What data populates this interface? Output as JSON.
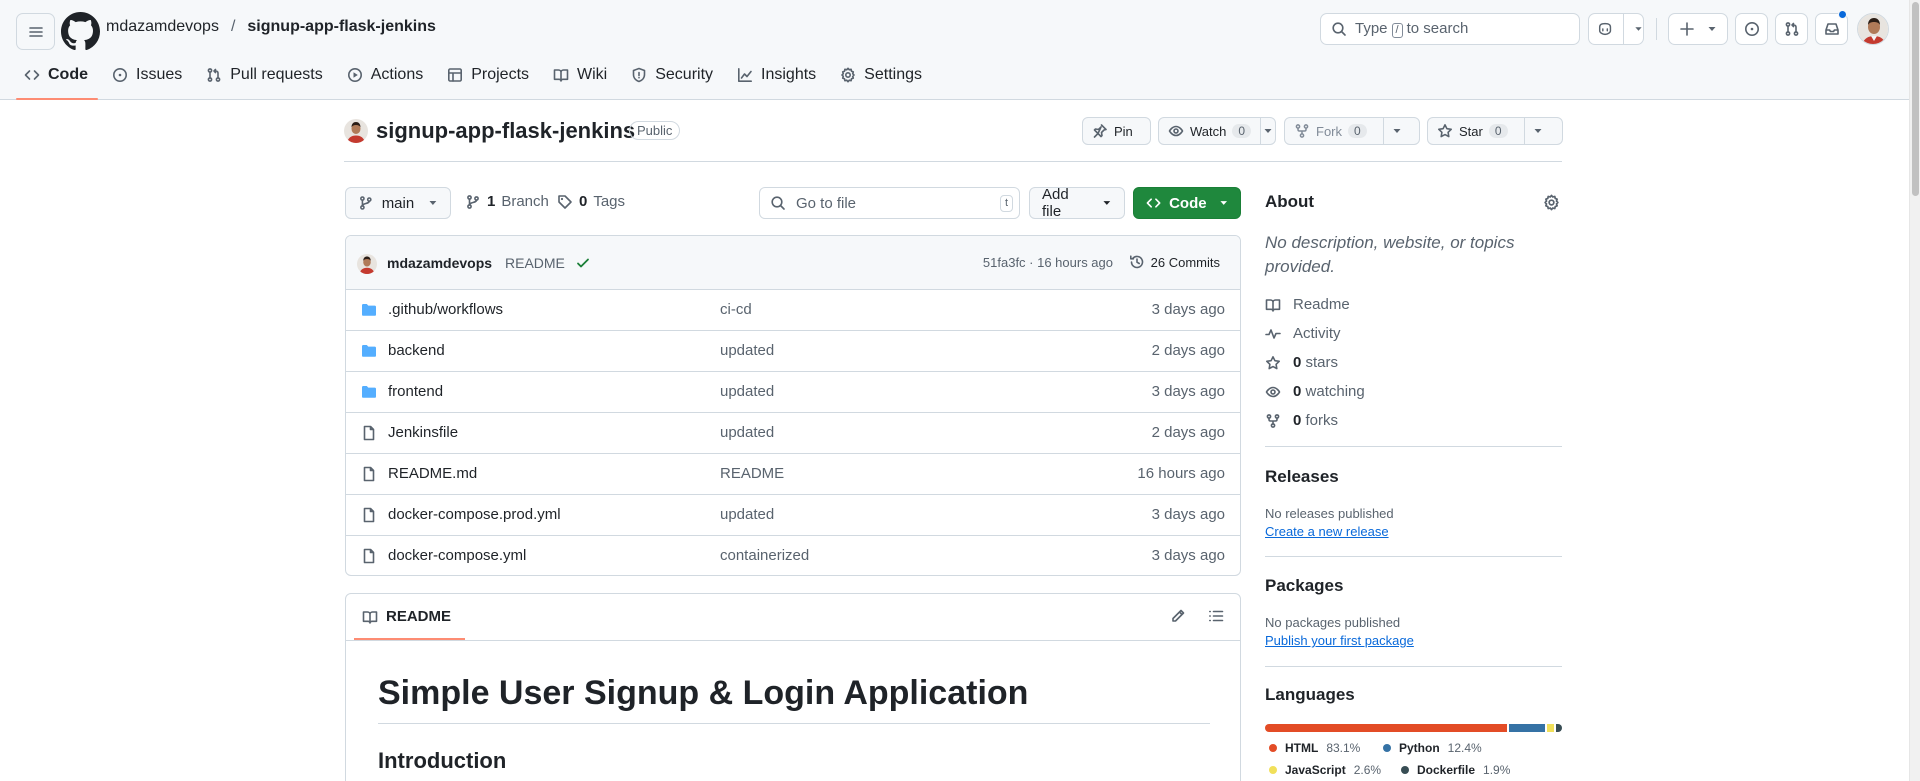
{
  "header": {
    "owner": "mdazamdevops",
    "separator": "/",
    "repo": "signup-app-flask-jenkins",
    "search_prefix": "Type",
    "search_key": "/",
    "search_suffix": "to search"
  },
  "tabs": [
    {
      "label": "Code",
      "icon": "code-icon",
      "active": true
    },
    {
      "label": "Issues",
      "icon": "issue-opened-icon"
    },
    {
      "label": "Pull requests",
      "icon": "git-pull-request-icon"
    },
    {
      "label": "Actions",
      "icon": "play-icon"
    },
    {
      "label": "Projects",
      "icon": "table-icon"
    },
    {
      "label": "Wiki",
      "icon": "book-icon"
    },
    {
      "label": "Security",
      "icon": "shield-icon"
    },
    {
      "label": "Insights",
      "icon": "graph-icon"
    },
    {
      "label": "Settings",
      "icon": "gear-icon"
    }
  ],
  "repo_header": {
    "name": "signup-app-flask-jenkins",
    "visibility": "Public",
    "pin_label": "Pin",
    "watch_label": "Watch",
    "watch_count": "0",
    "fork_label": "Fork",
    "fork_count": "0",
    "star_label": "Star",
    "star_count": "0"
  },
  "file_nav": {
    "branch": "main",
    "branch_count": "1",
    "branch_label": "Branch",
    "tag_count": "0",
    "tag_label": "Tags",
    "goto_placeholder": "Go to file",
    "goto_key": "t",
    "add_file_label": "Add file",
    "code_label": "Code"
  },
  "commit": {
    "author": "mdazamdevops",
    "message": "README",
    "meta": "51fa3fc · 16 hours ago",
    "commits_label": "26 Commits"
  },
  "files": [
    {
      "type": "folder",
      "name": ".github/workflows",
      "message": "ci-cd",
      "date": "3 days ago"
    },
    {
      "type": "folder",
      "name": "backend",
      "message": "updated",
      "date": "2 days ago"
    },
    {
      "type": "folder",
      "name": "frontend",
      "message": "updated",
      "date": "3 days ago"
    },
    {
      "type": "file",
      "name": "Jenkinsfile",
      "message": "updated",
      "date": "2 days ago"
    },
    {
      "type": "file",
      "name": "README.md",
      "message": "README",
      "date": "16 hours ago"
    },
    {
      "type": "file",
      "name": "docker-compose.prod.yml",
      "message": "updated",
      "date": "3 days ago"
    },
    {
      "type": "file",
      "name": "docker-compose.yml",
      "message": "containerized",
      "date": "3 days ago"
    }
  ],
  "readme": {
    "tab_label": "README",
    "h1": "Simple User Signup & Login Application",
    "h2": "Introduction"
  },
  "about": {
    "title": "About",
    "description": "No description, website, or topics provided.",
    "readme_label": "Readme",
    "activity_label": "Activity",
    "stars_count": "0",
    "stars_label": "stars",
    "watching_count": "0",
    "watching_label": "watching",
    "forks_count": "0",
    "forks_label": "forks"
  },
  "releases": {
    "title": "Releases",
    "empty": "No releases published",
    "link": "Create a new release"
  },
  "packages": {
    "title": "Packages",
    "empty": "No packages published",
    "link": "Publish your first package"
  },
  "languages": {
    "title": "Languages",
    "items": [
      {
        "name": "HTML",
        "percent": "83.1%",
        "value": 83.1,
        "color": "#e34c26"
      },
      {
        "name": "Python",
        "percent": "12.4%",
        "value": 12.4,
        "color": "#3572A5"
      },
      {
        "name": "JavaScript",
        "percent": "2.6%",
        "value": 2.6,
        "color": "#f1e05a"
      },
      {
        "name": "Dockerfile",
        "percent": "1.9%",
        "value": 1.9,
        "color": "#384d54"
      }
    ]
  },
  "colors": {
    "accent_tab": "#fd8c73",
    "primary_button": "#1f883d",
    "link": "#0969da",
    "folder_icon": "#54aeff",
    "success_check": "#1a7f37"
  }
}
